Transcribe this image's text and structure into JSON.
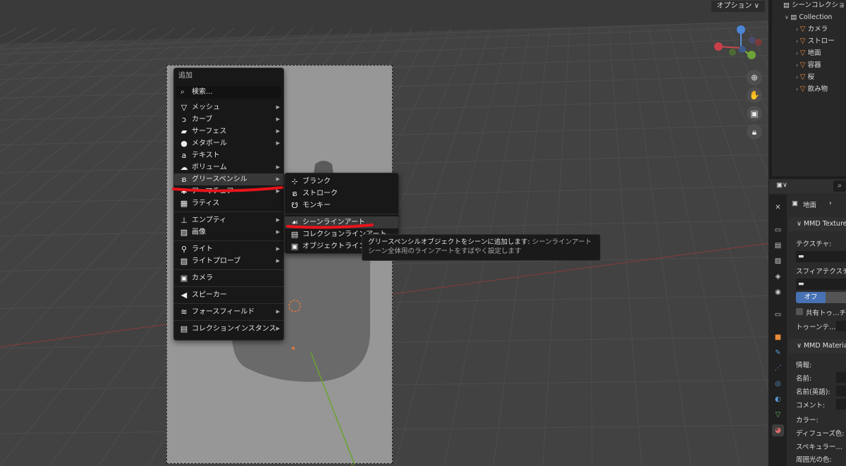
{
  "viewport": {
    "options_label": "オプション ∨"
  },
  "add_menu": {
    "title": "追加",
    "search_label": "検索...",
    "items": [
      {
        "label": "メッシュ",
        "icon": "mesh-icon",
        "glyph": "▽",
        "submenu": true
      },
      {
        "label": "カーブ",
        "icon": "curve-icon",
        "glyph": "ɔ",
        "submenu": true
      },
      {
        "label": "サーフェス",
        "icon": "surface-icon",
        "glyph": "▰",
        "submenu": true
      },
      {
        "label": "メタボール",
        "icon": "metaball-icon",
        "glyph": "●",
        "submenu": true
      },
      {
        "label": "テキスト",
        "icon": "text-icon",
        "glyph": "a",
        "submenu": false
      },
      {
        "label": "ボリューム",
        "icon": "volume-icon",
        "glyph": "☁",
        "submenu": true
      },
      {
        "label": "グリースペンシル",
        "icon": "grease-pencil-icon",
        "glyph": "ຣ",
        "submenu": true,
        "active": true
      },
      {
        "label": "アーマチュア",
        "icon": "armature-icon",
        "glyph": "✱",
        "submenu": true
      },
      {
        "label": "ラティス",
        "icon": "lattice-icon",
        "glyph": "▦",
        "submenu": false
      },
      {
        "label": "エンプティ",
        "icon": "empty-icon",
        "glyph": "⊥",
        "submenu": true
      },
      {
        "label": "画像",
        "icon": "image-icon",
        "glyph": "▨",
        "submenu": true
      },
      {
        "label": "ライト",
        "icon": "light-icon",
        "glyph": "⚲",
        "submenu": true
      },
      {
        "label": "ライトプローブ",
        "icon": "light-probe-icon",
        "glyph": "▨",
        "submenu": true
      },
      {
        "label": "カメラ",
        "icon": "camera-icon",
        "glyph": "▣",
        "submenu": false
      },
      {
        "label": "スピーカー",
        "icon": "speaker-icon",
        "glyph": "◀",
        "submenu": false
      },
      {
        "label": "フォースフィールド",
        "icon": "force-field-icon",
        "glyph": "≋",
        "submenu": true
      },
      {
        "label": "コレクションインスタンス",
        "icon": "collection-instance-icon",
        "glyph": "▤",
        "submenu": true
      }
    ]
  },
  "gp_submenu": {
    "items": [
      {
        "label": "ブランク",
        "icon": "blank-icon",
        "glyph": "⊹"
      },
      {
        "label": "ストローク",
        "icon": "stroke-icon",
        "glyph": "ຣ"
      },
      {
        "label": "モンキー",
        "icon": "monkey-icon",
        "glyph": "☋"
      },
      {
        "label": "シーンラインアート",
        "icon": "scene-lineart-icon",
        "glyph": "☙",
        "active": true
      },
      {
        "label": "コレクションラインアート",
        "icon": "collection-lineart-icon",
        "glyph": "▤"
      },
      {
        "label": "オブジェクトラインアート",
        "icon": "object-lineart-icon",
        "glyph": "▣"
      }
    ]
  },
  "tooltip": {
    "line1_main": "グリースペンシルオブジェクトをシーンに追加します: ",
    "line1_hint": "シーンラインアート",
    "line2_hint": "シーン全体用のラインアートをすばやく設定します"
  },
  "outliner": {
    "scene_collection": "シーンコレクション",
    "collection": "Collection",
    "objects": [
      "カメラ",
      "ストロー",
      "地面",
      "容器",
      "桜",
      "飲み物"
    ]
  },
  "properties": {
    "breadcrumb": "地面",
    "panel1_title": "MMD Texture",
    "texture_label": "テクスチャ:",
    "sphere_label": "スフィアテクスチ",
    "off_label": "オフ",
    "shared_toon_label": "共有トゥ…チ",
    "toon_label": "トゥーンテ…",
    "panel2_title": "MMD Material",
    "info_label": "情報:",
    "name_label": "名前:",
    "name_en_label": "名前(英語):",
    "comment_label": "コメント:",
    "color_label": "カラー:",
    "diffuse_label": "ディフューズ色:",
    "specular_label": "スペキュラー…",
    "ambient_label": "周囲光の色:"
  },
  "colors": {
    "accent_blue": "#4772b3",
    "annotation_red": "#e8141b",
    "object_orange": "#e88a3c"
  }
}
